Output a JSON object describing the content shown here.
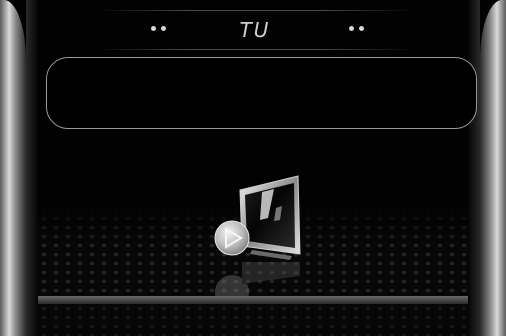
{
  "header": {
    "title": "TU",
    "left_indicator_icon": "dots-icon",
    "right_indicator_icon": "dots-icon"
  },
  "info_display": {
    "text": ""
  },
  "tv_source": {
    "icon": "tv-play-icon"
  },
  "colors": {
    "background": "#020202",
    "bezel": "#cfcfcf",
    "title": "#d0d0d0",
    "frame": "#9a9a9a"
  }
}
